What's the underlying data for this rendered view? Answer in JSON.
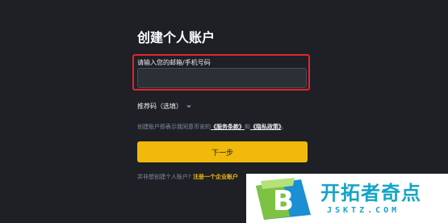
{
  "form": {
    "title": "创建个人账户",
    "email_label": "请输入您的邮箱/手机号码",
    "email_value": "",
    "referral_label": "推荐码（选填）",
    "terms_prefix": "创建账户即表示我同意币安的",
    "terms_service": "《服务条款》",
    "terms_and": "和",
    "terms_privacy": "《隐私政策》",
    "terms_suffix": "。",
    "next_button": "下一步",
    "bottom_prefix": "并非想创建个人账户?",
    "bottom_link": "注册一个企业账户"
  },
  "watermark": {
    "logo_letter": "B",
    "name": "开拓者奇点",
    "url": "JSKTZ.COM"
  },
  "colors": {
    "background": "#1e2026",
    "accent": "#f0b90b",
    "highlight_border": "#e5242b",
    "watermark_blue": "#16a4c4"
  },
  "icons": [
    "caret-down-icon",
    "logo-b-icon"
  ]
}
